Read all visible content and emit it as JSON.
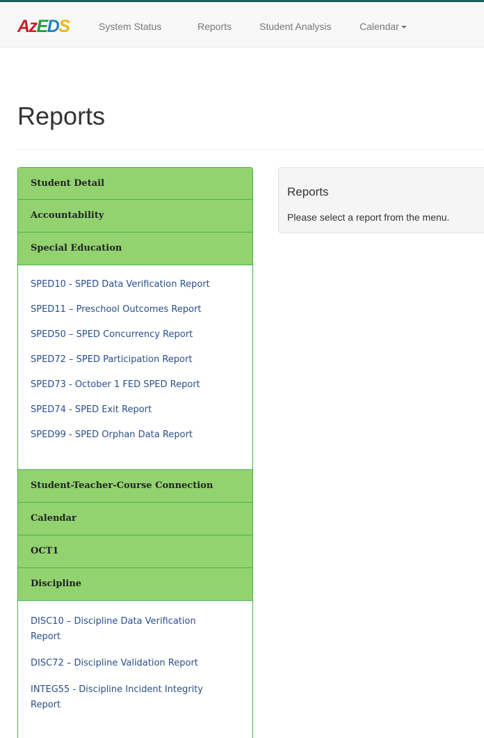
{
  "navbar": {
    "logo": {
      "az": "Az",
      "e": "E",
      "d": "D",
      "s": "S"
    },
    "items": [
      {
        "label": "System Status"
      },
      {
        "label": "Reports"
      },
      {
        "label": "Student Analysis"
      },
      {
        "label": "Calendar"
      }
    ]
  },
  "page": {
    "title": "Reports"
  },
  "menu": {
    "sections": [
      {
        "label": "Student Detail"
      },
      {
        "label": "Accountability"
      },
      {
        "label": "Special Education",
        "reports": [
          "SPED10 - SPED Data Verification Report",
          "SPED11 – Preschool Outcomes Report",
          "SPED50 – SPED Concurrency Report",
          "SPED72 – SPED Participation Report",
          "SPED73 - October 1 FED SPED Report",
          "SPED74 - SPED Exit Report",
          "SPED99 - SPED Orphan Data Report"
        ]
      },
      {
        "label": "Student-Teacher-Course Connection"
      },
      {
        "label": "Calendar"
      },
      {
        "label": "OCT1"
      },
      {
        "label": "Discipline",
        "reports": [
          "DISC10 – Discipline Data Verification Report",
          "DISC72 – Discipline Validation Report",
          "INTEG55 - Discipline Incident Integrity Report"
        ]
      }
    ]
  },
  "info_panel": {
    "title": "Reports",
    "text": "Please select a report from the menu."
  },
  "colors": {
    "section_header_bg": "#93d36f",
    "section_border": "#43b247",
    "link": "#2a4e8c"
  }
}
